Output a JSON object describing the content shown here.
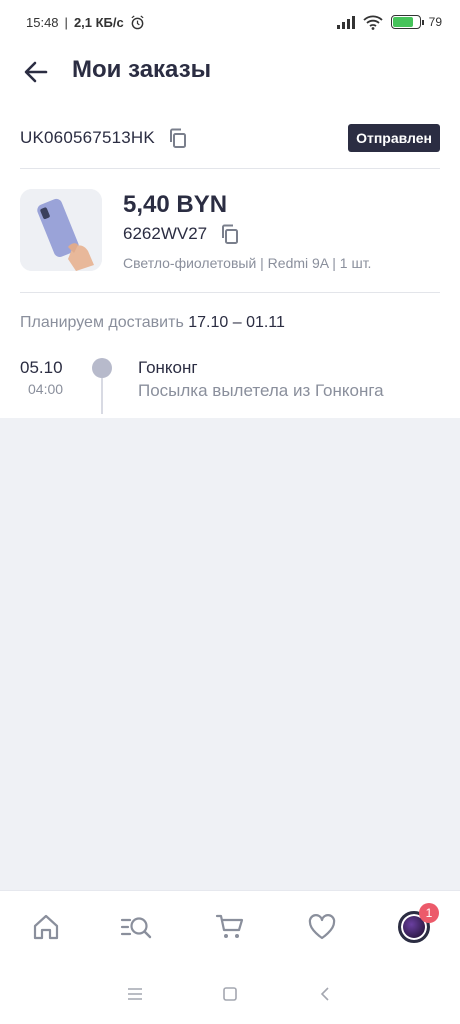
{
  "status_bar": {
    "time": "15:48",
    "speed": "2,1 КБ/с",
    "battery": "79"
  },
  "header": {
    "title": "Мои заказы"
  },
  "order": {
    "tracking_number": "UK060567513HK",
    "status": "Отправлен",
    "product": {
      "price": "5,40 BYN",
      "sku": "6262WV27",
      "meta": "Светло-фиолетовый | Redmi 9A | 1 шт."
    },
    "delivery_label": "Планируем доставить",
    "delivery_dates": "17.10 – 01.11",
    "events": [
      {
        "date": "05.10",
        "time": "04:00",
        "place": "Гонконг",
        "description": "Посылка вылетела из Гонконга"
      }
    ]
  },
  "bottom_nav": {
    "items": [
      "home-icon",
      "catalog-search-icon",
      "cart-icon",
      "favorites-heart-icon",
      "profile-avatar"
    ],
    "badge_count": "1"
  },
  "system_nav": [
    "menu-icon",
    "home-square-icon",
    "back-chevron-icon"
  ],
  "colors": {
    "primary_text": "#2b2d42",
    "secondary_text": "#8a8f9c",
    "badge": "#ec5a6a",
    "battery": "#46c35a",
    "background": "#eff1f5"
  }
}
